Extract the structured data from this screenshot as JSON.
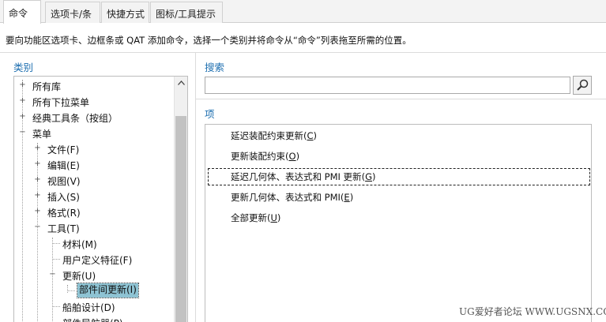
{
  "tabs": [
    {
      "label": "命令",
      "active": true
    },
    {
      "label": "选项卡/条",
      "active": false
    },
    {
      "label": "快捷方式",
      "active": false
    },
    {
      "label": "图标/工具提示",
      "active": false
    }
  ],
  "description": "要向功能区选项卡、边框条或 QAT 添加命令，选择一个类别并将命令从“命令”列表拖至所需的位置。",
  "category_label": "类别",
  "search_label": "搜索",
  "search": {
    "value": "",
    "placeholder": ""
  },
  "items_label": "项",
  "tree": [
    {
      "label": "所有库",
      "expander": "+"
    },
    {
      "label": "所有下拉菜单",
      "expander": "+"
    },
    {
      "label": "经典工具条（按组）",
      "expander": "+"
    },
    {
      "label": "菜单",
      "expander": "−"
    },
    {
      "label": "文件(F)",
      "expander": "+"
    },
    {
      "label": "编辑(E)",
      "expander": "+"
    },
    {
      "label": "视图(V)",
      "expander": "+"
    },
    {
      "label": "插入(S)",
      "expander": "+"
    },
    {
      "label": "格式(R)",
      "expander": "+"
    },
    {
      "label": "工具(T)",
      "expander": "−"
    },
    {
      "label": "材料(M)",
      "expander": ""
    },
    {
      "label": "用户定义特征(F)",
      "expander": ""
    },
    {
      "label": "更新(U)",
      "expander": "−"
    },
    {
      "label": "部件间更新(I)",
      "expander": "",
      "selected": true
    },
    {
      "label": "船舶设计(D)",
      "expander": ""
    },
    {
      "label": "部件导航器(P)",
      "expander": ""
    }
  ],
  "items": [
    {
      "text": "延迟装配约束更新",
      "key": "C"
    },
    {
      "text": "更新装配约束",
      "key": "O"
    },
    {
      "text": "延迟几何体、表达式和 PMI 更新",
      "key": "G",
      "focused": true
    },
    {
      "text": "更新几何体、表达式和 PMI",
      "key": "E"
    },
    {
      "text": "全部更新",
      "key": "U"
    }
  ],
  "watermark": "UG爱好者论坛 WWW.UGSNX.COM",
  "colors": {
    "section_label": "#1e6fb0",
    "selection": "#8ec3d3"
  },
  "icons": {
    "search_button": "magnifier-icon",
    "scroll_up": "chevron-up-icon"
  }
}
